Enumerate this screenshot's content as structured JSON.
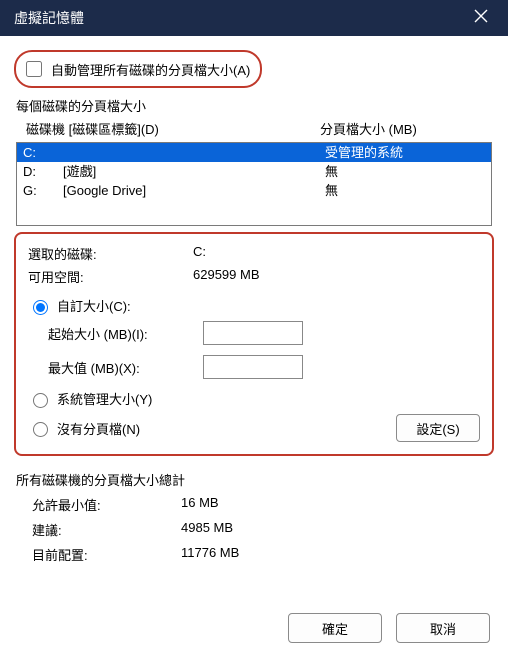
{
  "title": "虛擬記憶體",
  "auto_manage": {
    "label": "自動管理所有磁碟的分頁檔大小(A)",
    "checked": false
  },
  "per_drive_label": "每個磁碟的分頁檔大小",
  "col_drive": "磁碟機 [磁碟區標籤](D)",
  "col_size": "分頁檔大小 (MB)",
  "drives": [
    {
      "letter": "C:",
      "label": "",
      "size": "受管理的系統",
      "selected": true
    },
    {
      "letter": "D:",
      "label": "[遊戲]",
      "size": "無",
      "selected": false
    },
    {
      "letter": "G:",
      "label": "[Google Drive]",
      "size": "無",
      "selected": false
    }
  ],
  "selected_drive_label": "選取的磁碟:",
  "selected_drive_value": "C:",
  "free_space_label": "可用空間:",
  "free_space_value": "629599 MB",
  "radio_custom": "自訂大小(C):",
  "initial_label": "起始大小 (MB)(I):",
  "initial_value": "",
  "max_label": "最大值 (MB)(X):",
  "max_value": "",
  "radio_system": "系統管理大小(Y)",
  "radio_none": "沒有分頁檔(N)",
  "set_button": "設定(S)",
  "totals_label": "所有磁碟機的分頁檔大小總計",
  "min_label": "允許最小值:",
  "min_value": "16 MB",
  "rec_label": "建議:",
  "rec_value": "4985 MB",
  "cur_label": "目前配置:",
  "cur_value": "11776 MB",
  "ok_button": "確定",
  "cancel_button": "取消"
}
